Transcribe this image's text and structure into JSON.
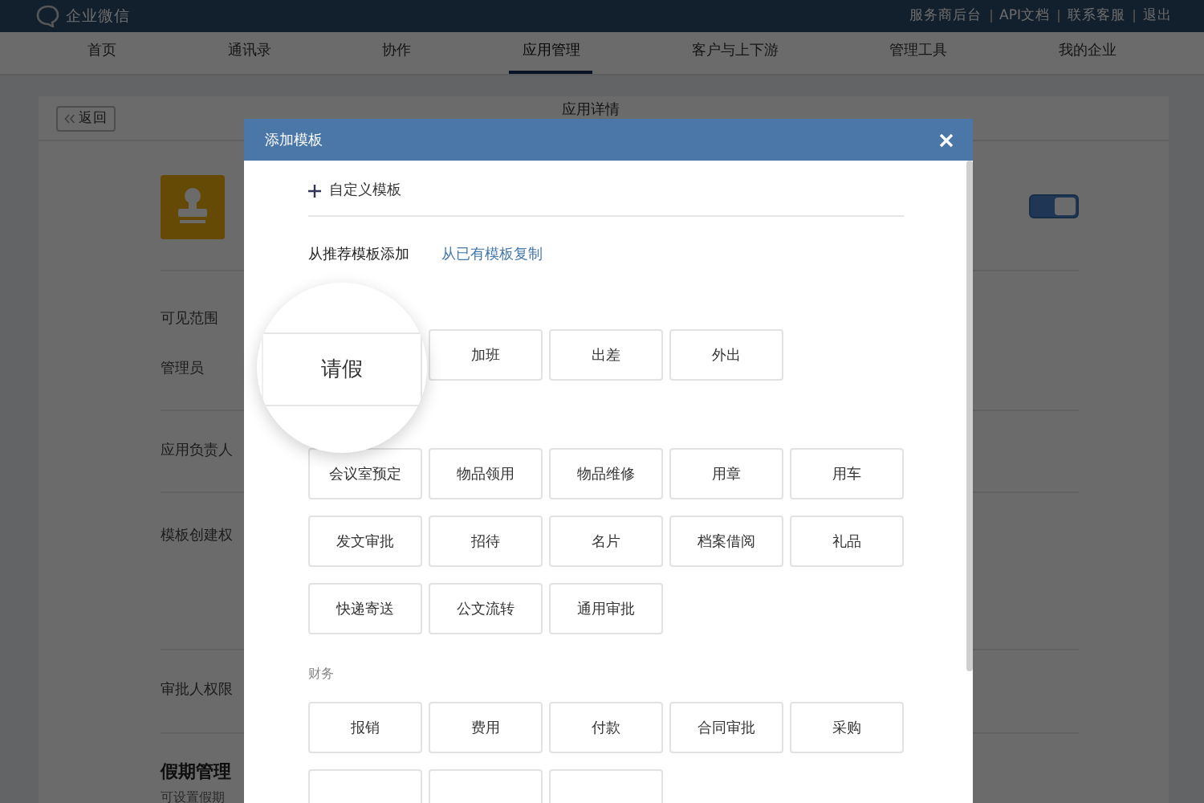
{
  "header": {
    "brand": "企业微信",
    "links": [
      "服务商后台",
      "API文档",
      "联系客服",
      "退出"
    ]
  },
  "nav": [
    {
      "label": "首页",
      "selected": false
    },
    {
      "label": "通讯录",
      "selected": false
    },
    {
      "label": "协作",
      "selected": false
    },
    {
      "label": "应用管理",
      "selected": true
    },
    {
      "label": "客户与上下游",
      "selected": false
    },
    {
      "label": "管理工具",
      "selected": false
    },
    {
      "label": "我的企业",
      "selected": false
    }
  ],
  "page": {
    "back_button": "返回",
    "title": "应用详情",
    "app_switch": {
      "on": true
    },
    "sections": [
      {
        "labels": [
          "可见范围",
          "管理员"
        ]
      },
      {
        "labels": [
          "应用负责人"
        ]
      },
      {
        "labels": [
          "模板创建权"
        ]
      },
      {
        "labels": [
          "审批人权限"
        ]
      }
    ],
    "holiday": {
      "title": "假期管理",
      "description": "可设置假期"
    }
  },
  "modal": {
    "title": "添加模板",
    "custom_link": "自定义模板",
    "tabs": [
      {
        "label": "从推荐模板添加",
        "selected": true
      },
      {
        "label": "从已有模板复制",
        "selected": false
      }
    ],
    "groups": [
      {
        "tiles": [
          "加班",
          "出差",
          "外出"
        ]
      },
      {
        "tiles": [
          "会议室预定",
          "物品领用",
          "物品维修",
          "用章",
          "用车",
          "发文审批",
          "招待",
          "名片",
          "档案借阅",
          "礼品",
          "快递寄送",
          "公文流转",
          "通用审批"
        ]
      },
      {
        "heading": "财务",
        "tiles": [
          "报销",
          "费用",
          "付款",
          "合同审批",
          "采购"
        ],
        "cut_tiles": [
          {
            "kind": "tile"
          },
          {
            "kind": "tile"
          },
          {
            "kind": "tile"
          }
        ]
      }
    ],
    "magnifier": {
      "label": "请假"
    }
  }
}
